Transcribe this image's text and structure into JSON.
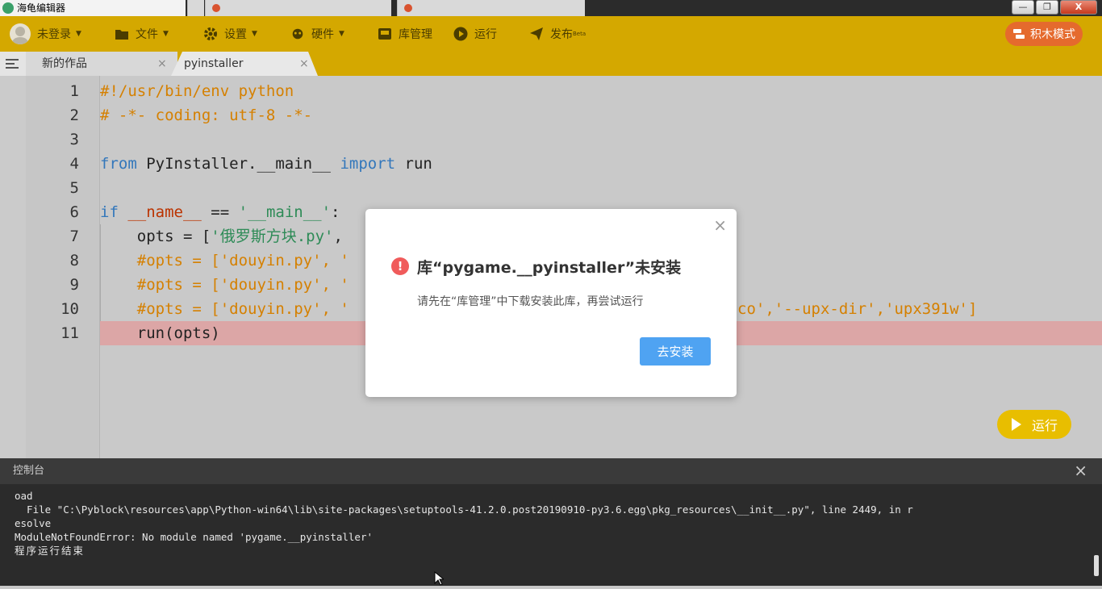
{
  "window": {
    "title": "海龟编辑器",
    "controls": {
      "minimize": "—",
      "maximize": "❐",
      "close": "X"
    }
  },
  "toolbar": {
    "login": "未登录",
    "file": "文件",
    "settings": "设置",
    "hardware": "硬件",
    "library": "库管理",
    "run": "运行",
    "publish": "发布",
    "publish_badge": "Beta",
    "block_mode": "积木模式"
  },
  "tabs": [
    {
      "label": "新的作品",
      "close": "×"
    },
    {
      "label": "pyinstaller",
      "close": "×"
    }
  ],
  "editor": {
    "line_numbers": [
      "1",
      "2",
      "3",
      "4",
      "5",
      "6",
      "7",
      "8",
      "9",
      "10",
      "11"
    ],
    "lines": [
      {
        "t": "#!/usr/bin/env python"
      },
      {
        "t": "# -*- coding: utf-8 -*-"
      },
      {
        "t": ""
      },
      {
        "kw1": "from",
        "mod": " PyInstaller.__main__ ",
        "kw2": "import",
        "rest": " run"
      },
      {
        "t": ""
      },
      {
        "kw": "if",
        "v": " __name__ ",
        "op": "==",
        "sp": " ",
        "str": "'__main__'",
        "end": ":"
      },
      {
        "pre": "    opts = [",
        "str": "'俄罗斯方块.py'",
        "end": ","
      },
      {
        "t": "    #opts = ['douyin.py', '"
      },
      {
        "t": "    #opts = ['douyin.py', '"
      },
      {
        "left": "    #opts = ['douyin.py', '",
        "right": "co','--upx-dir','upx391w']"
      },
      {
        "t": "    run(opts)"
      }
    ],
    "run_button": "运行",
    "error_line": 11
  },
  "dialog": {
    "title": "库“pygame.__pyinstaller”未安装",
    "message": "请先在“库管理”中下载安装此库，再尝试运行",
    "button": "去安装",
    "close": "×",
    "icon": "!"
  },
  "console": {
    "title": "控制台",
    "close": "×",
    "lines": [
      "oad",
      "  File \"C:\\Pyblock\\resources\\app\\Python-win64\\lib\\site-packages\\setuptools-41.2.0.post20190910-py3.6.egg\\pkg_resources\\__init__.py\", line 2449, in r",
      "esolve",
      "ModuleNotFoundError: No module named 'pygame.__pyinstaller'",
      "程序运行结束"
    ]
  },
  "colors": {
    "toolbar": "#d4a800",
    "block_mode": "#e56a2d",
    "dialog_button": "#4fa3f2",
    "error_icon": "#f05b5b",
    "error_line": "#dca6a6",
    "comment": "#d58000",
    "keyword": "#3377bb",
    "string": "#2e8b57"
  }
}
